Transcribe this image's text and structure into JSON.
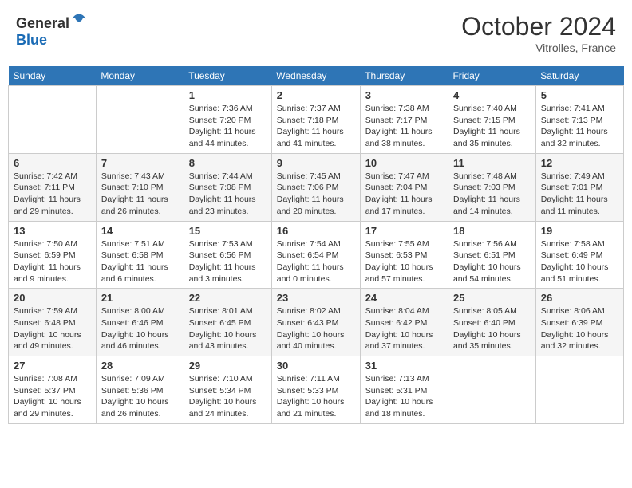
{
  "header": {
    "logo_general": "General",
    "logo_blue": "Blue",
    "month": "October 2024",
    "location": "Vitrolles, France"
  },
  "days_of_week": [
    "Sunday",
    "Monday",
    "Tuesday",
    "Wednesday",
    "Thursday",
    "Friday",
    "Saturday"
  ],
  "weeks": [
    [
      {
        "day": "",
        "info": ""
      },
      {
        "day": "",
        "info": ""
      },
      {
        "day": "1",
        "info": "Sunrise: 7:36 AM\nSunset: 7:20 PM\nDaylight: 11 hours and 44 minutes."
      },
      {
        "day": "2",
        "info": "Sunrise: 7:37 AM\nSunset: 7:18 PM\nDaylight: 11 hours and 41 minutes."
      },
      {
        "day": "3",
        "info": "Sunrise: 7:38 AM\nSunset: 7:17 PM\nDaylight: 11 hours and 38 minutes."
      },
      {
        "day": "4",
        "info": "Sunrise: 7:40 AM\nSunset: 7:15 PM\nDaylight: 11 hours and 35 minutes."
      },
      {
        "day": "5",
        "info": "Sunrise: 7:41 AM\nSunset: 7:13 PM\nDaylight: 11 hours and 32 minutes."
      }
    ],
    [
      {
        "day": "6",
        "info": "Sunrise: 7:42 AM\nSunset: 7:11 PM\nDaylight: 11 hours and 29 minutes."
      },
      {
        "day": "7",
        "info": "Sunrise: 7:43 AM\nSunset: 7:10 PM\nDaylight: 11 hours and 26 minutes."
      },
      {
        "day": "8",
        "info": "Sunrise: 7:44 AM\nSunset: 7:08 PM\nDaylight: 11 hours and 23 minutes."
      },
      {
        "day": "9",
        "info": "Sunrise: 7:45 AM\nSunset: 7:06 PM\nDaylight: 11 hours and 20 minutes."
      },
      {
        "day": "10",
        "info": "Sunrise: 7:47 AM\nSunset: 7:04 PM\nDaylight: 11 hours and 17 minutes."
      },
      {
        "day": "11",
        "info": "Sunrise: 7:48 AM\nSunset: 7:03 PM\nDaylight: 11 hours and 14 minutes."
      },
      {
        "day": "12",
        "info": "Sunrise: 7:49 AM\nSunset: 7:01 PM\nDaylight: 11 hours and 11 minutes."
      }
    ],
    [
      {
        "day": "13",
        "info": "Sunrise: 7:50 AM\nSunset: 6:59 PM\nDaylight: 11 hours and 9 minutes."
      },
      {
        "day": "14",
        "info": "Sunrise: 7:51 AM\nSunset: 6:58 PM\nDaylight: 11 hours and 6 minutes."
      },
      {
        "day": "15",
        "info": "Sunrise: 7:53 AM\nSunset: 6:56 PM\nDaylight: 11 hours and 3 minutes."
      },
      {
        "day": "16",
        "info": "Sunrise: 7:54 AM\nSunset: 6:54 PM\nDaylight: 11 hours and 0 minutes."
      },
      {
        "day": "17",
        "info": "Sunrise: 7:55 AM\nSunset: 6:53 PM\nDaylight: 10 hours and 57 minutes."
      },
      {
        "day": "18",
        "info": "Sunrise: 7:56 AM\nSunset: 6:51 PM\nDaylight: 10 hours and 54 minutes."
      },
      {
        "day": "19",
        "info": "Sunrise: 7:58 AM\nSunset: 6:49 PM\nDaylight: 10 hours and 51 minutes."
      }
    ],
    [
      {
        "day": "20",
        "info": "Sunrise: 7:59 AM\nSunset: 6:48 PM\nDaylight: 10 hours and 49 minutes."
      },
      {
        "day": "21",
        "info": "Sunrise: 8:00 AM\nSunset: 6:46 PM\nDaylight: 10 hours and 46 minutes."
      },
      {
        "day": "22",
        "info": "Sunrise: 8:01 AM\nSunset: 6:45 PM\nDaylight: 10 hours and 43 minutes."
      },
      {
        "day": "23",
        "info": "Sunrise: 8:02 AM\nSunset: 6:43 PM\nDaylight: 10 hours and 40 minutes."
      },
      {
        "day": "24",
        "info": "Sunrise: 8:04 AM\nSunset: 6:42 PM\nDaylight: 10 hours and 37 minutes."
      },
      {
        "day": "25",
        "info": "Sunrise: 8:05 AM\nSunset: 6:40 PM\nDaylight: 10 hours and 35 minutes."
      },
      {
        "day": "26",
        "info": "Sunrise: 8:06 AM\nSunset: 6:39 PM\nDaylight: 10 hours and 32 minutes."
      }
    ],
    [
      {
        "day": "27",
        "info": "Sunrise: 7:08 AM\nSunset: 5:37 PM\nDaylight: 10 hours and 29 minutes."
      },
      {
        "day": "28",
        "info": "Sunrise: 7:09 AM\nSunset: 5:36 PM\nDaylight: 10 hours and 26 minutes."
      },
      {
        "day": "29",
        "info": "Sunrise: 7:10 AM\nSunset: 5:34 PM\nDaylight: 10 hours and 24 minutes."
      },
      {
        "day": "30",
        "info": "Sunrise: 7:11 AM\nSunset: 5:33 PM\nDaylight: 10 hours and 21 minutes."
      },
      {
        "day": "31",
        "info": "Sunrise: 7:13 AM\nSunset: 5:31 PM\nDaylight: 10 hours and 18 minutes."
      },
      {
        "day": "",
        "info": ""
      },
      {
        "day": "",
        "info": ""
      }
    ]
  ]
}
